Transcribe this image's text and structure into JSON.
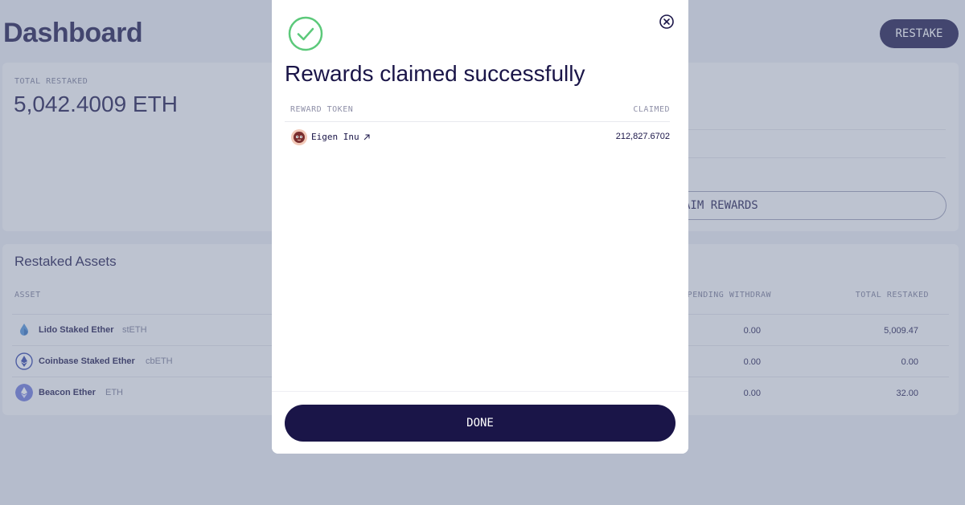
{
  "page": {
    "title": "Dashboard",
    "restake_label": "RESTAKE"
  },
  "summary": {
    "total_label": "TOTAL RESTAKED",
    "total_value": "5,042.4009 ETH",
    "claim_label": "AIM REWARDS"
  },
  "assets": {
    "title": "Restaked Assets",
    "columns": {
      "asset": "ASSET",
      "pending": "PENDING WITHDRAW",
      "total": "TOTAL RESTAKED"
    },
    "rows": [
      {
        "name": "Lido Staked Ether",
        "symbol": "stETH",
        "pending": "0.00",
        "total": "5,009.47",
        "icon": "steth-icon"
      },
      {
        "name": "Coinbase Staked Ether",
        "symbol": "cbETH",
        "pending": "0.00",
        "total": "0.00",
        "icon": "cbeth-icon"
      },
      {
        "name": "Beacon Ether",
        "symbol": "ETH",
        "pending": "0.00",
        "total": "32.00",
        "icon": "eth-icon"
      }
    ]
  },
  "modal": {
    "title": "Rewards claimed successfully",
    "columns": {
      "token": "REWARD TOKEN",
      "claimed": "CLAIMED"
    },
    "rows": [
      {
        "token": "Eigen Inu",
        "claimed": "212,827.6702",
        "icon": "eigen-inu-icon"
      }
    ],
    "done_label": "DONE",
    "icons": {
      "success": "check-circle-icon",
      "close": "close-icon"
    }
  },
  "colors": {
    "brand": "#1a1548",
    "success": "#5cc97a",
    "overlay": "#7682a0"
  }
}
